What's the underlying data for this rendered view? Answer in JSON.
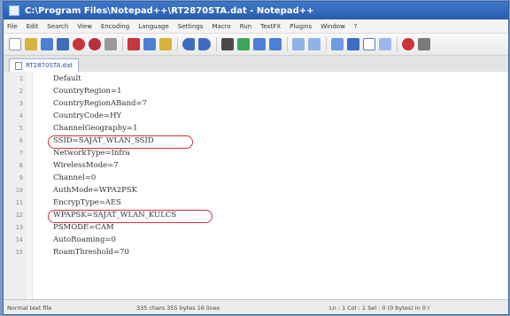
{
  "window": {
    "title": "C:\\Program Files\\Notepad++\\RT2870STA.dat - Notepad++"
  },
  "menu": [
    "File",
    "Edit",
    "Search",
    "View",
    "Encoding",
    "Language",
    "Settings",
    "Macro",
    "Run",
    "TextFX",
    "Plugins",
    "Window",
    "?"
  ],
  "toolbar": {
    "icons": [
      "new-file-icon",
      "open-file-icon",
      "save-icon",
      "save-all-icon",
      "close-icon",
      "close-all-icon",
      "print-icon",
      "cut-icon",
      "copy-icon",
      "paste-icon",
      "undo-icon",
      "redo-icon",
      "find-icon",
      "replace-icon",
      "zoom-in-icon",
      "zoom-out-icon",
      "sync-v-icon",
      "sync-h-icon",
      "wrap-icon",
      "show-all-icon",
      "indent-guide-icon",
      "record-macro-icon",
      "stop-macro-icon",
      "play-macro-icon"
    ],
    "colors": {
      "blue": "#4d7fd6",
      "green": "#3fa35a",
      "red": "#c9343d",
      "yellow": "#d8b23a",
      "gray": "#9a9a9a"
    }
  },
  "tab": {
    "label": "RT2870STA.dat"
  },
  "editor": {
    "lines": [
      {
        "n": "1",
        "text": "Default"
      },
      {
        "n": "2",
        "text": "CountryRegion=1"
      },
      {
        "n": "3",
        "text": "CountryRegionABand=7"
      },
      {
        "n": "4",
        "text": "CountryCode=HY"
      },
      {
        "n": "5",
        "text": "ChannelGeography=1"
      },
      {
        "n": "6",
        "text": "SSID=SAJAT_WLAN_SSID"
      },
      {
        "n": "7",
        "text": "NetworkType=Infra"
      },
      {
        "n": "8",
        "text": "WirelessMode=7"
      },
      {
        "n": "9",
        "text": "Channel=0"
      },
      {
        "n": "10",
        "text": "AuthMode=WPA2PSK"
      },
      {
        "n": "11",
        "text": "EncrypType=AES"
      },
      {
        "n": "12",
        "text": "WPAPSK=SAJAT_WLAN_KULCS"
      },
      {
        "n": "13",
        "text": "PSMODE=CAM"
      },
      {
        "n": "14",
        "text": "AutoRoaming=0"
      },
      {
        "n": "15",
        "text": "RoamThreshold=70"
      }
    ],
    "highlight_color": "#d1303a"
  },
  "status": {
    "type": "Normal text file",
    "stats": "335 chars   355 bytes   16 lines",
    "position": "Ln : 1    Col : 1    Sel : 0 (0 bytes) in 0 r"
  }
}
